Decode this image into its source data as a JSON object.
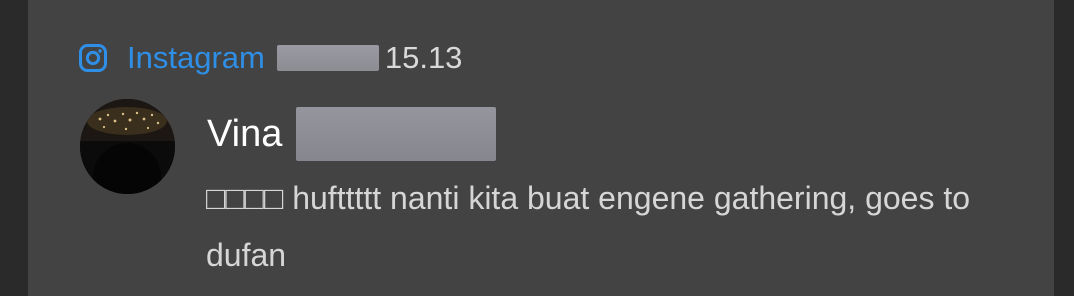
{
  "notification": {
    "app_name": "Instagram",
    "time": "15.13",
    "sender": "Vina",
    "message": "□□□□ hufttttt nanti kita buat engene gathering, goes to dufan"
  },
  "icons": {
    "app_icon": "instagram-icon",
    "avatar": "avatar"
  },
  "colors": {
    "background": "#2a2a2a",
    "card": "#434343",
    "app_name": "#2f8fe6",
    "time": "#d9d9d9",
    "sender": "#ffffff",
    "message": "#d6d6d6"
  }
}
